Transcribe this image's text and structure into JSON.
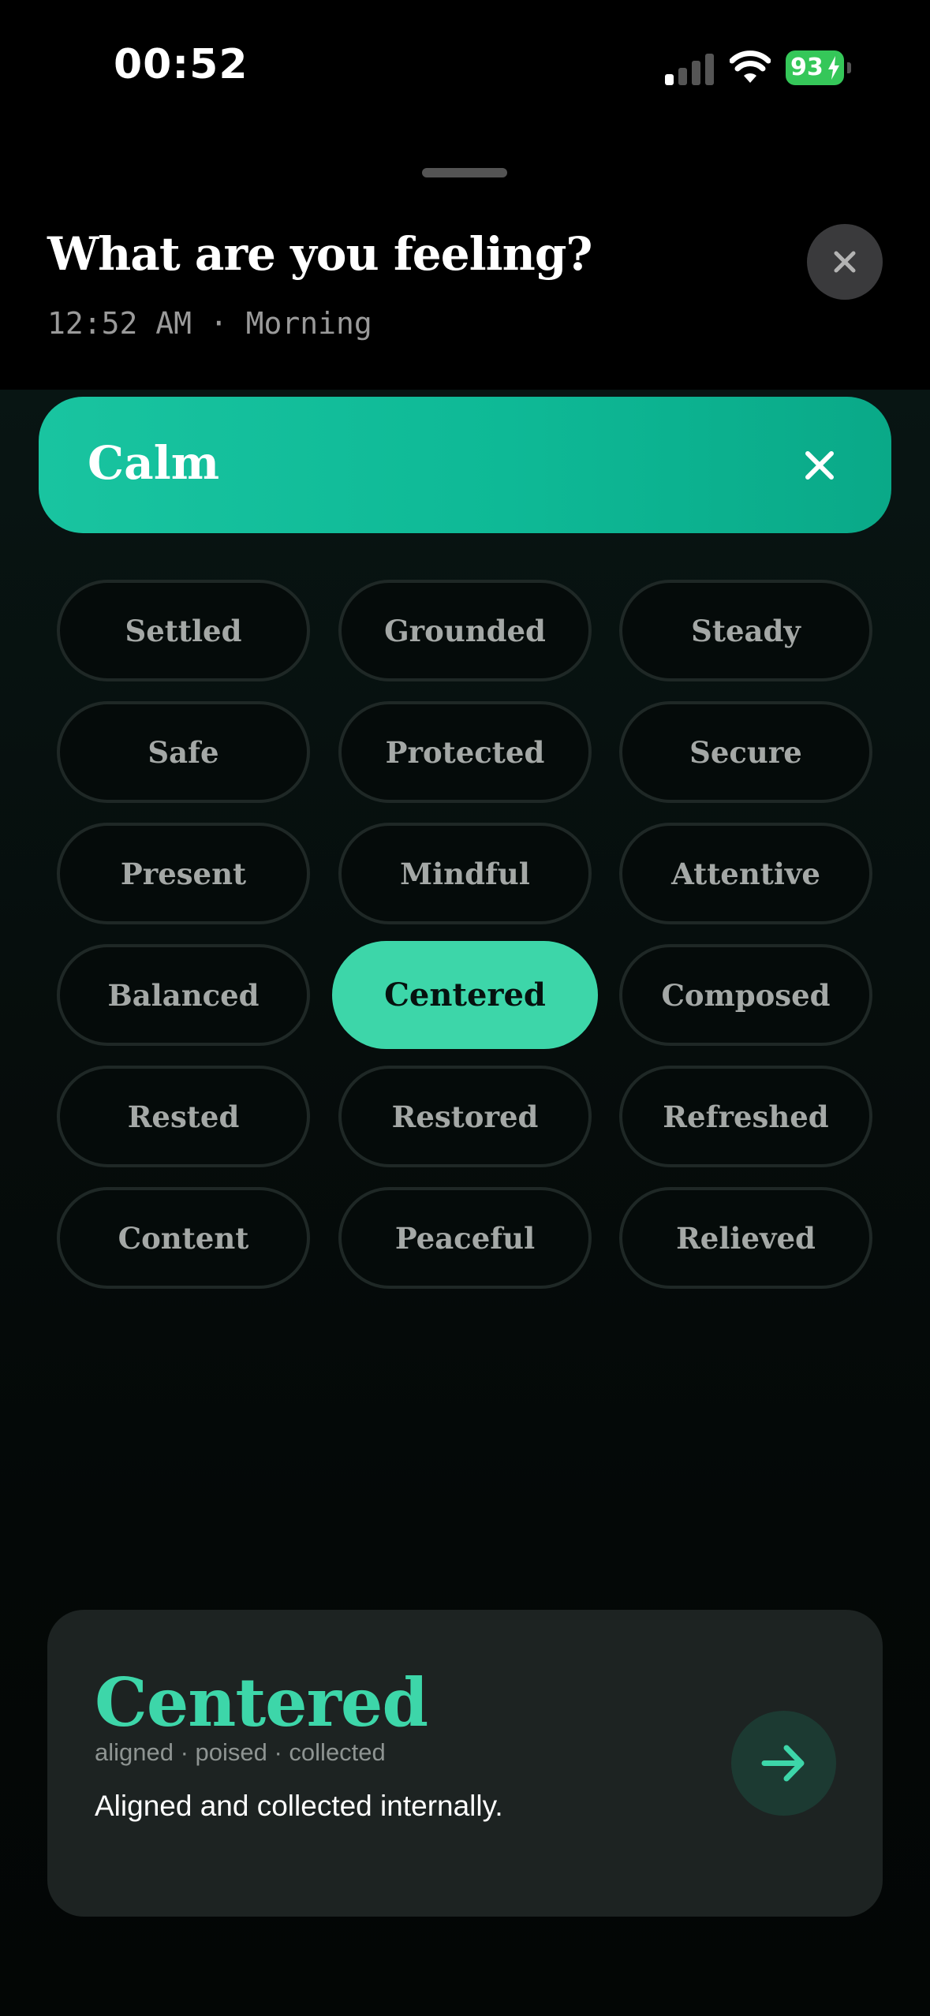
{
  "status_bar": {
    "time": "00:52",
    "battery": "93",
    "icons": [
      "signal-icon",
      "wifi-icon",
      "battery-charging-icon"
    ]
  },
  "sheet": {
    "title": "What are you feeling?",
    "subtitle": "12:52 AM · Morning",
    "close_icon": "close-icon"
  },
  "category": {
    "label": "Calm",
    "close_icon": "close-icon",
    "color": "#19c4a0"
  },
  "feelings": [
    {
      "label": "Settled",
      "selected": false
    },
    {
      "label": "Grounded",
      "selected": false
    },
    {
      "label": "Steady",
      "selected": false
    },
    {
      "label": "Safe",
      "selected": false
    },
    {
      "label": "Protected",
      "selected": false
    },
    {
      "label": "Secure",
      "selected": false
    },
    {
      "label": "Present",
      "selected": false
    },
    {
      "label": "Mindful",
      "selected": false
    },
    {
      "label": "Attentive",
      "selected": false
    },
    {
      "label": "Balanced",
      "selected": false
    },
    {
      "label": "Centered",
      "selected": true
    },
    {
      "label": "Composed",
      "selected": false
    },
    {
      "label": "Rested",
      "selected": false
    },
    {
      "label": "Restored",
      "selected": false
    },
    {
      "label": "Refreshed",
      "selected": false
    },
    {
      "label": "Content",
      "selected": false
    },
    {
      "label": "Peaceful",
      "selected": false
    },
    {
      "label": "Relieved",
      "selected": false
    }
  ],
  "detail": {
    "title": "Centered",
    "synonyms": "aligned · poised · collected",
    "description": "Aligned and collected internally.",
    "action_icon": "arrow-right-icon"
  },
  "colors": {
    "accent": "#3dd6a9",
    "card": "#1d2322",
    "background": "#000000"
  }
}
